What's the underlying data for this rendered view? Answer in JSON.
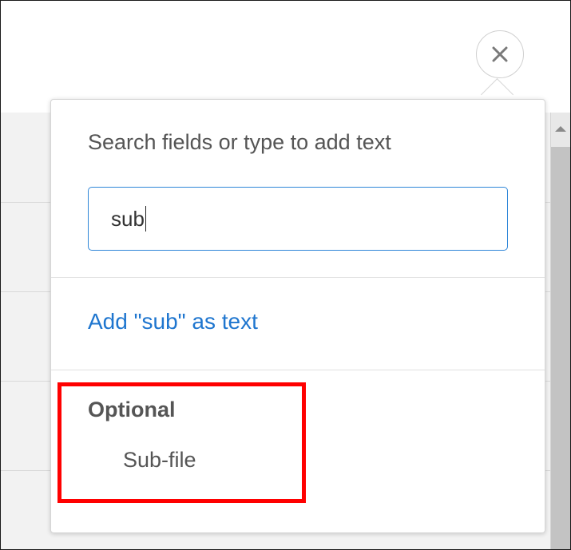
{
  "popup": {
    "title": "Search fields or type to add text",
    "search_value": "sub",
    "add_text_link": "Add \"sub\" as text",
    "group_label": "Optional",
    "options": [
      "Sub-file"
    ]
  },
  "close_button": {
    "icon": "close-icon"
  },
  "annotation": {
    "highlight_color": "#ff0000"
  },
  "colors": {
    "link": "#1f76cf",
    "input_border": "#2f86d8",
    "text": "#555555"
  }
}
